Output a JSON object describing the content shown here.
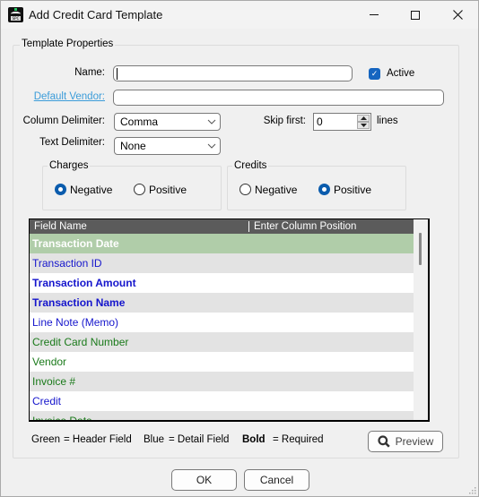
{
  "window": {
    "title": "Add Credit Card Template",
    "icon": "app-logo-icon",
    "app_icon_text": "SPC",
    "controls": [
      "minimize-icon",
      "maximize-icon",
      "close-icon"
    ]
  },
  "template_properties": {
    "group_label": "Template Properties",
    "name_label": "Name:",
    "name_value": "",
    "active_label": "Active",
    "active_checked": true,
    "default_vendor_label": "Default Vendor:",
    "default_vendor_value": "",
    "column_delimiter_label": "Column Delimiter:",
    "column_delimiter_value": "Comma",
    "text_delimiter_label": "Text Delimiter:",
    "text_delimiter_value": "None",
    "skip_first_label": "Skip first:",
    "skip_first_value": "0",
    "lines_label": "lines"
  },
  "charges": {
    "group_label": "Charges",
    "options": [
      {
        "label": "Negative",
        "selected": true
      },
      {
        "label": "Positive",
        "selected": false
      }
    ]
  },
  "credits": {
    "group_label": "Credits",
    "options": [
      {
        "label": "Negative",
        "selected": false
      },
      {
        "label": "Positive",
        "selected": true
      }
    ]
  },
  "grid": {
    "columns": [
      "Field Name",
      "Enter Column Position"
    ],
    "rows": [
      {
        "field": "Transaction Date",
        "position": "",
        "type": "header",
        "required": true,
        "selected": true
      },
      {
        "field": "Transaction ID",
        "position": "",
        "type": "detail",
        "required": false
      },
      {
        "field": "Transaction Amount",
        "position": "",
        "type": "detail",
        "required": true
      },
      {
        "field": "Transaction Name",
        "position": "",
        "type": "detail",
        "required": true
      },
      {
        "field": "Line Note (Memo)",
        "position": "",
        "type": "detail",
        "required": false
      },
      {
        "field": "Credit Card Number",
        "position": "",
        "type": "header",
        "required": false
      },
      {
        "field": "Vendor",
        "position": "",
        "type": "header",
        "required": false
      },
      {
        "field": "Invoice #",
        "position": "",
        "type": "header",
        "required": false
      },
      {
        "field": "Credit",
        "position": "",
        "type": "detail",
        "required": false
      },
      {
        "field": "Invoice Date",
        "position": "",
        "type": "header",
        "required": false
      }
    ]
  },
  "legend": {
    "green_word": "Green",
    "green_desc": "= Header Field",
    "blue_word": "Blue",
    "blue_desc": "= Detail Field",
    "bold_word": "Bold",
    "bold_desc": "= Required"
  },
  "buttons": {
    "preview": "Preview",
    "ok": "OK",
    "cancel": "Cancel"
  },
  "colors": {
    "header_field": "#1a7a1a",
    "detail_field": "#1515cc",
    "selected_row": "#b0cda9",
    "accent": "#0b5cad",
    "link": "#3b9cd9"
  }
}
